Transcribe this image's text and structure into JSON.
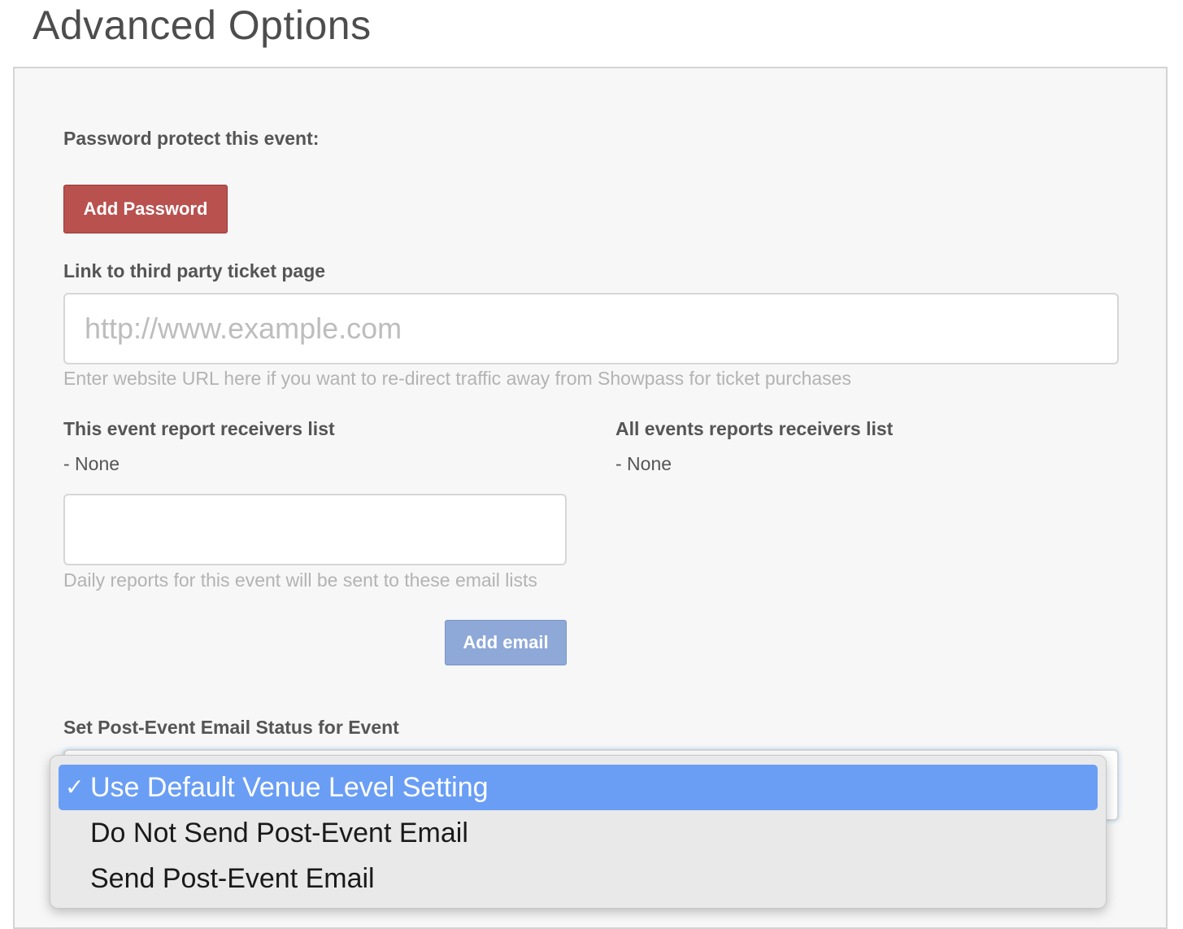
{
  "header": {
    "title": "Advanced Options"
  },
  "password": {
    "label": "Password protect this event:",
    "button_label": "Add Password"
  },
  "third_party": {
    "label": "Link to third party ticket page",
    "placeholder": "http://www.example.com",
    "value": "",
    "help": "Enter website URL here if you want to re-direct traffic away from Showpass for ticket purchases"
  },
  "event_receivers": {
    "label": "This event report receivers list",
    "items_text": "- None",
    "input_value": "",
    "help": "Daily reports for this event will be sent to these email lists",
    "button_label": "Add email"
  },
  "all_receivers": {
    "label": "All events reports receivers list",
    "items_text": "- None"
  },
  "post_event_email": {
    "label": "Set Post-Event Email Status for Event",
    "selected": "Use Default Venue Level Setting",
    "check_glyph": "✓",
    "options": [
      "Use Default Venue Level Setting",
      "Do Not Send Post-Event Email",
      "Send Post-Event Email"
    ]
  },
  "colors": {
    "danger_button": "#b9514f",
    "primary_button_disabled": "#8ea8d8",
    "dropdown_highlight": "#6a9ef5",
    "panel_background": "#f7f7f7"
  }
}
